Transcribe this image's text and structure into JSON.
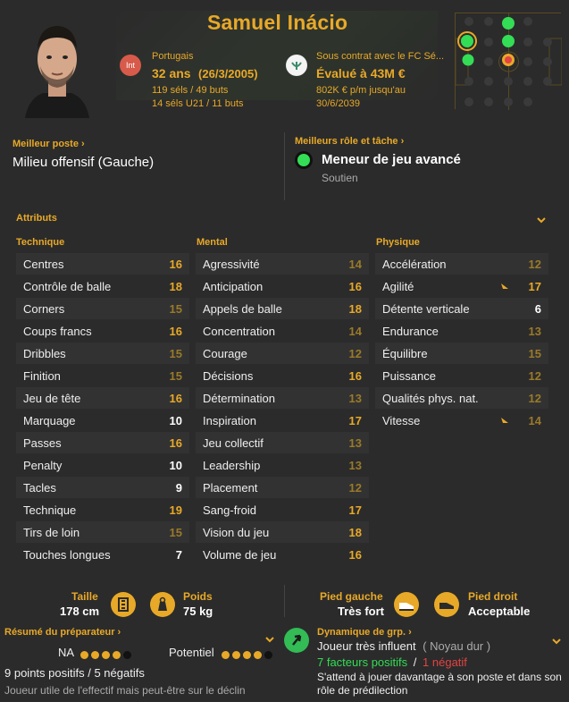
{
  "player": {
    "name": "Samuel Inácio",
    "int_label": "Int",
    "nation": "Portugais",
    "age_label": "32 ans",
    "dob": "(26/3/2005)",
    "caps": "119 séls / 49 buts",
    "u21": "14 séls U21 / 11 buts",
    "contract_with": "Sous contrat avec le FC Sé...",
    "value": "Évalué à 43M €",
    "wage": "802K € p/m jusqu'au",
    "contract_end": "30/6/2039"
  },
  "best_position": {
    "title": "Meilleur poste",
    "value": "Milieu offensif (Gauche)"
  },
  "best_role": {
    "title": "Meilleurs rôle et tâche",
    "role": "Meneur de jeu avancé",
    "duty": "Soutien"
  },
  "attributes": {
    "title": "Attributs",
    "technique": {
      "title": "Technique",
      "items": [
        {
          "label": "Centres",
          "value": "16"
        },
        {
          "label": "Contrôle de balle",
          "value": "18"
        },
        {
          "label": "Corners",
          "value": "15"
        },
        {
          "label": "Coups francs",
          "value": "16"
        },
        {
          "label": "Dribbles",
          "value": "15"
        },
        {
          "label": "Finition",
          "value": "15"
        },
        {
          "label": "Jeu de tête",
          "value": "16"
        },
        {
          "label": "Marquage",
          "value": "10"
        },
        {
          "label": "Passes",
          "value": "16"
        },
        {
          "label": "Penalty",
          "value": "10"
        },
        {
          "label": "Tacles",
          "value": "9"
        },
        {
          "label": "Technique",
          "value": "19"
        },
        {
          "label": "Tirs de loin",
          "value": "15"
        },
        {
          "label": "Touches longues",
          "value": "7"
        }
      ]
    },
    "mental": {
      "title": "Mental",
      "items": [
        {
          "label": "Agressivité",
          "value": "14"
        },
        {
          "label": "Anticipation",
          "value": "16"
        },
        {
          "label": "Appels de balle",
          "value": "18"
        },
        {
          "label": "Concentration",
          "value": "14"
        },
        {
          "label": "Courage",
          "value": "12"
        },
        {
          "label": "Décisions",
          "value": "16"
        },
        {
          "label": "Détermination",
          "value": "13"
        },
        {
          "label": "Inspiration",
          "value": "17"
        },
        {
          "label": "Jeu collectif",
          "value": "13"
        },
        {
          "label": "Leadership",
          "value": "13"
        },
        {
          "label": "Placement",
          "value": "12"
        },
        {
          "label": "Sang-froid",
          "value": "17"
        },
        {
          "label": "Vision du jeu",
          "value": "18"
        },
        {
          "label": "Volume de jeu",
          "value": "16"
        }
      ]
    },
    "physique": {
      "title": "Physique",
      "items": [
        {
          "label": "Accélération",
          "value": "12"
        },
        {
          "label": "Agilité",
          "value": "17"
        },
        {
          "label": "Détente verticale",
          "value": "6"
        },
        {
          "label": "Endurance",
          "value": "13"
        },
        {
          "label": "Équilibre",
          "value": "15"
        },
        {
          "label": "Puissance",
          "value": "12"
        },
        {
          "label": "Qualités phys. nat.",
          "value": "12"
        },
        {
          "label": "Vitesse",
          "value": "14"
        }
      ]
    }
  },
  "body": {
    "height_label": "Taille",
    "height": "178 cm",
    "weight_label": "Poids",
    "weight": "75 kg",
    "left_foot_label": "Pied gauche",
    "left_foot": "Très fort",
    "right_foot_label": "Pied droit",
    "right_foot": "Acceptable"
  },
  "coach_report": {
    "title": "Résumé du préparateur",
    "ca_label": "NA",
    "ca_stars": 4,
    "pa_label": "Potentiel",
    "pa_stars": 4,
    "points": "9 points positifs / 5 négatifs",
    "summary": "Joueur utile de l'effectif mais peut-être sur le déclin"
  },
  "dynamics": {
    "title": "Dynamique de grp.",
    "influence": "Joueur très influent",
    "group": "( Noyau dur )",
    "positive": "7 facteurs positifs",
    "separator": "/",
    "negative": "1 négatif",
    "note": "S'attend à jouer davantage à son poste et dans son rôle de prédilection"
  },
  "colors": {
    "accent": "#e8a928",
    "green": "#33dd55",
    "red": "#e04444"
  }
}
